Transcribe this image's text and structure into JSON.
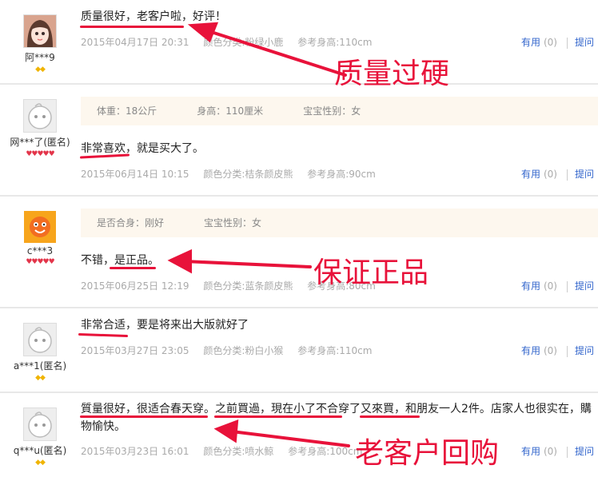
{
  "reviews": [
    {
      "username": "阿***9",
      "badges": "◆◆",
      "content": "质量很好，老客户啦，好评！",
      "date": "2015年04月17日 20:31",
      "color": "颜色分类:粉绿小鹿",
      "size": "参考身高:110cm",
      "useful_label": "有用",
      "useful_count": "(0)",
      "reply_label": "提问"
    },
    {
      "username": "网***了(匿名)",
      "badges": "♥♥♥♥♥",
      "extra": [
        "体重：18公斤",
        "身高：110厘米",
        "宝宝性别：女"
      ],
      "content": "非常喜欢，就是买大了。",
      "date": "2015年06月14日 10:15",
      "color": "颜色分类:桔条颜皮熊",
      "size": "参考身高:90cm",
      "useful_label": "有用",
      "useful_count": "(0)",
      "reply_label": "提问"
    },
    {
      "username": "c***3",
      "badges": "♥♥♥♥♥",
      "extra": [
        "是否合身：刚好",
        "宝宝性别：女"
      ],
      "content": "不错，是正品。",
      "date": "2015年06月25日 12:19",
      "color": "颜色分类:蓝条颜皮熊",
      "size": "参考身高:80cm",
      "useful_label": "有用",
      "useful_count": "(0)",
      "reply_label": "提问"
    },
    {
      "username": "a***1(匿名)",
      "badges": "◆◆",
      "content": "非常合适，要是将来出大版就好了",
      "date": "2015年03月27日 23:05",
      "color": "颜色分类:粉白小猴",
      "size": "参考身高:110cm",
      "useful_label": "有用",
      "useful_count": "(0)",
      "reply_label": "提问"
    },
    {
      "username": "q***u(匿名)",
      "badges": "◆◆",
      "content": "質量很好，很适合春天穿。之前買過，現在小了不合穿了又來買，和朋友一人2件。店家人也很实在，購物愉快。",
      "date": "2015年03月23日 16:01",
      "color": "颜色分类:喷水鲸",
      "size": "参考身高:100cm",
      "useful_label": "有用",
      "useful_count": "(0)",
      "reply_label": "提问"
    }
  ],
  "annotations": {
    "note1": "质量过硬",
    "note2": "保证正品",
    "note3": "老客户回购",
    "color": "#e8123a"
  }
}
